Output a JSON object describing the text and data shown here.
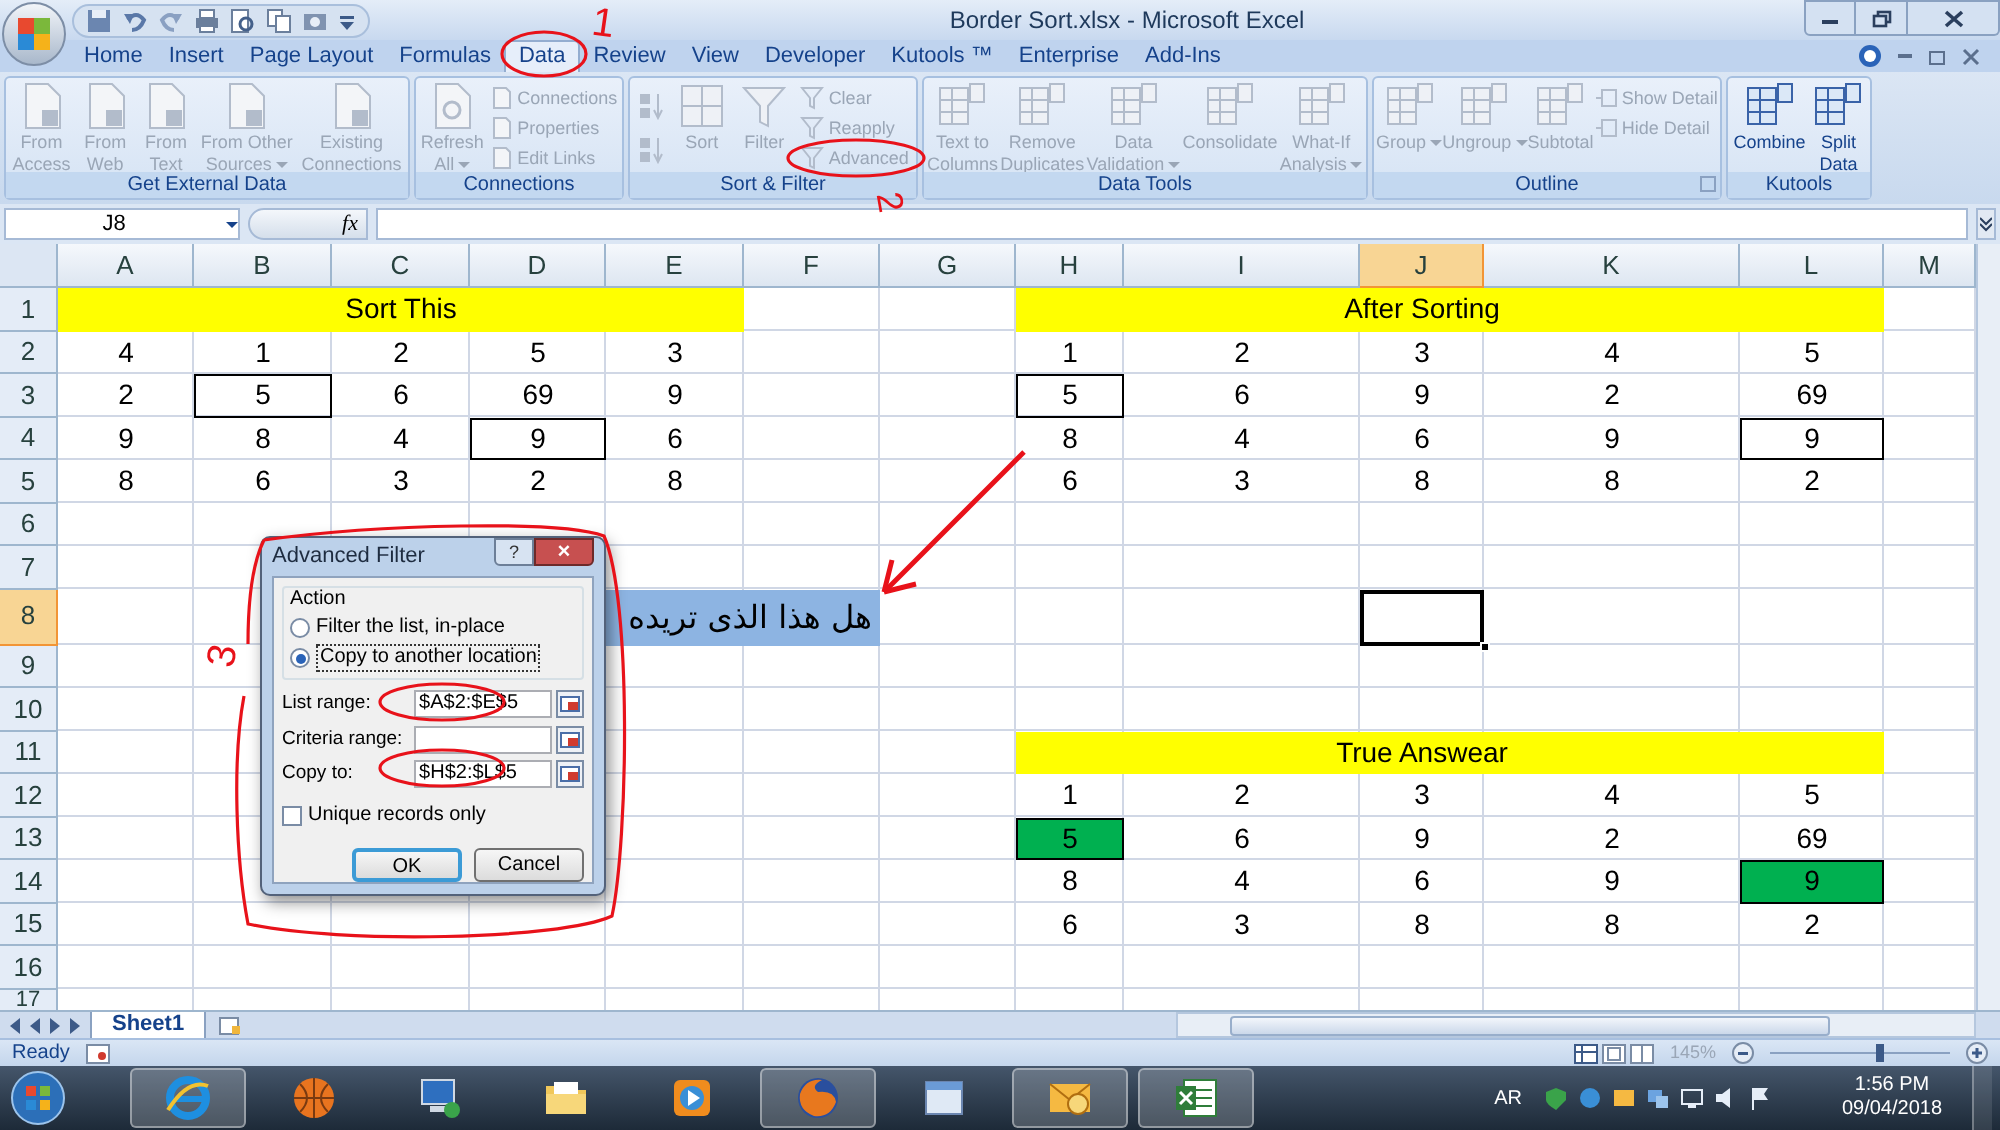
{
  "window": {
    "title": "Border Sort.xlsx - Microsoft Excel"
  },
  "tabs": [
    {
      "label": "Home",
      "selected": false
    },
    {
      "label": "Insert",
      "selected": false
    },
    {
      "label": "Page Layout",
      "selected": false
    },
    {
      "label": "Formulas",
      "selected": false
    },
    {
      "label": "Data",
      "selected": true
    },
    {
      "label": "Review",
      "selected": false
    },
    {
      "label": "View",
      "selected": false
    },
    {
      "label": "Developer",
      "selected": false
    },
    {
      "label": "Kutools ™",
      "selected": false
    },
    {
      "label": "Enterprise",
      "selected": false
    },
    {
      "label": "Add-Ins",
      "selected": false
    }
  ],
  "ribbon": [
    {
      "label": "Get External Data",
      "items": [
        {
          "kind": "large",
          "label": "From\nAccess",
          "disabled": true
        },
        {
          "kind": "large",
          "label": "From\nWeb",
          "disabled": true
        },
        {
          "kind": "large",
          "label": "From\nText",
          "disabled": true
        },
        {
          "kind": "large",
          "label": "From Other\nSources",
          "disabled": true,
          "dropdown": true
        },
        {
          "kind": "large",
          "label": "Existing\nConnections",
          "disabled": true
        }
      ]
    },
    {
      "label": "Connections",
      "items": [
        {
          "kind": "large",
          "label": "Refresh\nAll",
          "disabled": true,
          "dropdown": true
        },
        {
          "kind": "small",
          "label": "Connections",
          "disabled": true
        },
        {
          "kind": "small",
          "label": "Properties",
          "disabled": true
        },
        {
          "kind": "small",
          "label": "Edit Links",
          "disabled": true
        }
      ]
    },
    {
      "label": "Sort & Filter",
      "items": [
        {
          "kind": "sort",
          "disabled": true
        },
        {
          "kind": "sort",
          "disabled": true
        },
        {
          "kind": "large",
          "label": "Sort",
          "disabled": true
        },
        {
          "kind": "large",
          "label": "Filter",
          "disabled": true
        },
        {
          "kind": "small",
          "label": "Clear",
          "disabled": true
        },
        {
          "kind": "small",
          "label": "Reapply",
          "disabled": true
        },
        {
          "kind": "small",
          "label": "Advanced",
          "disabled": true
        }
      ]
    },
    {
      "label": "Data Tools",
      "items": [
        {
          "kind": "large",
          "label": "Text to\nColumns",
          "disabled": true
        },
        {
          "kind": "large",
          "label": "Remove\nDuplicates",
          "disabled": true
        },
        {
          "kind": "large",
          "label": "Data\nValidation",
          "disabled": true,
          "dropdown": true
        },
        {
          "kind": "large",
          "label": "Consolidate",
          "disabled": true
        },
        {
          "kind": "large",
          "label": "What-If\nAnalysis",
          "disabled": true,
          "dropdown": true
        }
      ]
    },
    {
      "label": "Outline",
      "launcher": true,
      "items": [
        {
          "kind": "large",
          "label": "Group",
          "disabled": true,
          "dropdown": true
        },
        {
          "kind": "large",
          "label": "Ungroup",
          "disabled": true,
          "dropdown": true
        },
        {
          "kind": "large",
          "label": "Subtotal",
          "disabled": true
        },
        {
          "kind": "small",
          "label": "Show Detail",
          "disabled": true
        },
        {
          "kind": "small",
          "label": "Hide Detail",
          "disabled": true
        }
      ]
    },
    {
      "label": "Kutools",
      "items": [
        {
          "kind": "large",
          "label": "Combine",
          "disabled": false
        },
        {
          "kind": "large",
          "label": "Split\nData",
          "disabled": false
        }
      ]
    }
  ],
  "formula_bar": {
    "name_box": "J8",
    "fx": "fx"
  },
  "sheet": {
    "columns": [
      {
        "label": "A",
        "selected": false
      },
      {
        "label": "B",
        "selected": false
      },
      {
        "label": "C",
        "selected": false
      },
      {
        "label": "D",
        "selected": false
      },
      {
        "label": "E",
        "selected": false
      },
      {
        "label": "F",
        "selected": false
      },
      {
        "label": "G",
        "selected": false
      },
      {
        "label": "H",
        "selected": false
      },
      {
        "label": "I",
        "selected": false
      },
      {
        "label": "J",
        "selected": true
      },
      {
        "label": "K",
        "selected": false
      },
      {
        "label": "L",
        "selected": false
      },
      {
        "label": "M",
        "selected": false
      }
    ],
    "rows": [
      {
        "header": "1",
        "selected": false,
        "cells": [
          {
            "color": "#ffff00"
          },
          {
            "color": "#ffff00"
          },
          {
            "kind": "centered",
            "value": "Sort This",
            "color": "#ffff00"
          },
          {
            "color": "#ffff00"
          },
          {
            "color": "#ffff00"
          },
          null,
          null,
          {
            "color": "#ffff00"
          },
          {
            "color": "#ffff00"
          },
          {
            "kind": "centered",
            "value": "After Sorting",
            "color": "#ffff00"
          },
          {
            "color": "#ffff00"
          },
          {
            "color": "#ffff00"
          },
          null
        ]
      },
      {
        "header": "2",
        "selected": false,
        "cells": [
          "4",
          "1",
          "2",
          "5",
          "3",
          null,
          null,
          "1",
          "2",
          "3",
          "4",
          "5",
          null
        ]
      },
      {
        "header": "3",
        "selected": false,
        "cells": [
          "2",
          {
            "value": "5",
            "bordered": true
          },
          "6",
          "69",
          "9",
          null,
          null,
          {
            "value": "5",
            "bordered": true
          },
          "6",
          "9",
          "2",
          "69",
          null
        ]
      },
      {
        "header": "4",
        "selected": false,
        "cells": [
          "9",
          "8",
          "4",
          {
            "value": "9",
            "bordered": true
          },
          "6",
          null,
          null,
          "8",
          "4",
          "6",
          "9",
          {
            "value": "9",
            "bordered": true
          },
          null
        ]
      },
      {
        "header": "5",
        "selected": false,
        "cells": [
          "8",
          "6",
          "3",
          "2",
          "8",
          null,
          null,
          "6",
          "3",
          "8",
          "8",
          "2",
          null
        ]
      },
      {
        "header": "6",
        "selected": false,
        "cells": [
          null,
          null,
          null,
          null,
          null,
          null,
          null,
          null,
          null,
          null,
          null,
          null,
          null
        ]
      },
      {
        "header": "7",
        "selected": false,
        "cells": [
          null,
          null,
          null,
          null,
          null,
          null,
          null,
          null,
          null,
          null,
          null,
          null,
          null
        ]
      },
      {
        "header": "8",
        "selected": true,
        "cells": [
          null,
          null,
          null,
          null,
          {
            "color": "#8db4e2"
          },
          {
            "kind": "text",
            "value": "هل هذا الذى تريده",
            "color": "#8db4e2"
          },
          null,
          null,
          null,
          {
            "selected": true
          },
          null,
          null,
          null
        ]
      },
      {
        "header": "9",
        "selected": false,
        "cells": [
          null,
          null,
          null,
          null,
          null,
          null,
          null,
          null,
          null,
          null,
          null,
          null,
          null
        ]
      },
      {
        "header": "10",
        "selected": false,
        "cells": [
          null,
          null,
          null,
          null,
          null,
          null,
          null,
          null,
          null,
          null,
          null,
          null,
          null
        ]
      },
      {
        "header": "11",
        "selected": false,
        "cells": [
          null,
          null,
          null,
          null,
          null,
          null,
          null,
          {
            "color": "#ffff00"
          },
          {
            "color": "#ffff00"
          },
          {
            "kind": "centered",
            "value": "True Answear",
            "color": "#ffff00"
          },
          {
            "color": "#ffff00"
          },
          {
            "color": "#ffff00"
          },
          null
        ]
      },
      {
        "header": "12",
        "selected": false,
        "cells": [
          null,
          null,
          null,
          null,
          null,
          null,
          null,
          "1",
          "2",
          "3",
          "4",
          "5",
          null
        ]
      },
      {
        "header": "13",
        "selected": false,
        "cells": [
          null,
          null,
          null,
          null,
          null,
          null,
          null,
          {
            "value": "5",
            "bordered": true,
            "color": "#00b050"
          },
          "6",
          "9",
          "2",
          "69",
          null
        ]
      },
      {
        "header": "14",
        "selected": false,
        "cells": [
          null,
          null,
          null,
          null,
          null,
          null,
          null,
          "8",
          "4",
          "6",
          "9",
          {
            "value": "9",
            "bordered": true,
            "color": "#00b050"
          },
          null
        ]
      },
      {
        "header": "15",
        "selected": false,
        "cells": [
          null,
          null,
          null,
          null,
          null,
          null,
          null,
          "6",
          "3",
          "8",
          "8",
          "2",
          null
        ]
      },
      {
        "header": "16",
        "selected": false,
        "cells": [
          null,
          null,
          null,
          null,
          null,
          null,
          null,
          null,
          null,
          null,
          null,
          null,
          null
        ]
      },
      {
        "header": "17",
        "selected": false,
        "cells": [
          null,
          null,
          null,
          null,
          null,
          null,
          null,
          null,
          null,
          null,
          null,
          null,
          null
        ]
      }
    ]
  },
  "dialog": {
    "title": "Advanced Filter",
    "help_button": "?",
    "close_button": "×",
    "group_label": "Action",
    "options": [
      {
        "label": "Filter the list, in-place",
        "selected": false
      },
      {
        "label": "Copy to another location",
        "selected": true
      }
    ],
    "fields": [
      {
        "label": "List range:",
        "value": "$A$2:$E$5"
      },
      {
        "label": "Criteria range:"
      },
      {
        "label": "Copy to:",
        "value": "$H$2:$L$5"
      }
    ],
    "checkbox": {
      "label": "Unique records only",
      "checked": false
    },
    "buttons": [
      "OK",
      "Cancel"
    ]
  },
  "sheet_tabs": [
    {
      "label": "Sheet1",
      "selected": true
    }
  ],
  "status_bar": {
    "text": "Ready",
    "zoom": {
      "reading": "145%",
      "level": 0.62
    }
  },
  "annotations": [
    "1",
    "2",
    "3"
  ],
  "taskbar": {
    "apps": [
      {
        "running": true
      },
      {
        "running": false
      },
      {
        "running": false
      },
      {
        "running": false
      },
      {
        "running": false
      },
      {
        "running": true
      },
      {
        "running": false
      },
      {
        "running": true
      },
      {
        "running": true
      }
    ],
    "language": "AR",
    "time": "1:56 PM",
    "date": "09/04/2018"
  }
}
